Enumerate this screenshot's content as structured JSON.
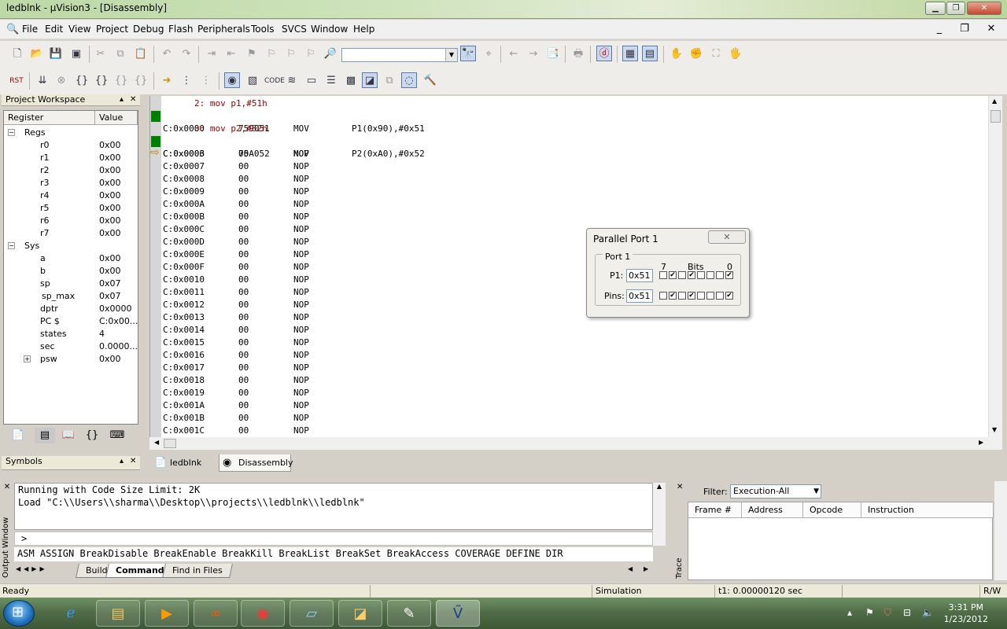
{
  "window": {
    "title": "ledblnk - µVision3 - [Disassembly]",
    "minimize": "▁",
    "maximize": "❐",
    "close": "✕"
  },
  "menu": [
    "File",
    "Edit",
    "View",
    "Project",
    "Debug",
    "Flash",
    "Peripherals",
    "Tools",
    "SVCS",
    "Window",
    "Help"
  ],
  "mdi": {
    "minimize": "_",
    "restore": "❐",
    "close": "✕"
  },
  "workspace": {
    "title": "Project Workspace",
    "pin": "▴",
    "close": "✕",
    "col_register": "Register",
    "col_value": "Value",
    "groups": [
      {
        "name": "Regs",
        "toggle": "−"
      },
      {
        "name": "Sys",
        "toggle": "−"
      }
    ],
    "regs": [
      {
        "name": "r0",
        "value": "0x00"
      },
      {
        "name": "r1",
        "value": "0x00"
      },
      {
        "name": "r2",
        "value": "0x00"
      },
      {
        "name": "r3",
        "value": "0x00"
      },
      {
        "name": "r4",
        "value": "0x00"
      },
      {
        "name": "r5",
        "value": "0x00"
      },
      {
        "name": "r6",
        "value": "0x00"
      },
      {
        "name": "r7",
        "value": "0x00"
      }
    ],
    "sys": [
      {
        "name": "a",
        "value": "0x00"
      },
      {
        "name": "b",
        "value": "0x00"
      },
      {
        "name": "sp",
        "value": "0x07"
      },
      {
        "name": "sp_max",
        "value": "0x07"
      },
      {
        "name": "dptr",
        "value": "0x0000"
      },
      {
        "name": "PC  $",
        "value": "C:0x00..."
      },
      {
        "name": "states",
        "value": "4"
      },
      {
        "name": "sec",
        "value": "0.0000..."
      },
      {
        "name": "psw",
        "value": "0x00",
        "toggle": "+"
      }
    ]
  },
  "symbols": {
    "title": "Symbols",
    "pin": "▴",
    "close": "✕"
  },
  "disassembly": {
    "src1": "2: mov p1,#51h",
    "src2": "3: mov p2,#52h",
    "instr": [
      {
        "addr": "C:0x0000",
        "bytes": "759051",
        "mn": "MOV",
        "ops": "P1(0x90),#0x51"
      },
      {
        "addr": "C:0x0003",
        "bytes": "75A052",
        "mn": "MOV",
        "ops": "P2(0xA0),#0x52"
      }
    ],
    "nops": [
      "C:0x0006",
      "C:0x0007",
      "C:0x0008",
      "C:0x0009",
      "C:0x000A",
      "C:0x000B",
      "C:0x000C",
      "C:0x000D",
      "C:0x000E",
      "C:0x000F",
      "C:0x0010",
      "C:0x0011",
      "C:0x0012",
      "C:0x0013",
      "C:0x0014",
      "C:0x0015",
      "C:0x0016",
      "C:0x0017",
      "C:0x0018",
      "C:0x0019",
      "C:0x001A",
      "C:0x001B",
      "C:0x001C"
    ],
    "nop_bytes": "00",
    "nop_mn": "NOP",
    "arrow": "⇨"
  },
  "doc_tabs": [
    "ledblnk",
    "Disassembly"
  ],
  "parallel_port": {
    "title": "Parallel Port 1",
    "close": "✕",
    "group": "Port 1",
    "bit_hi": "7",
    "bits_label": "Bits",
    "bit_lo": "0",
    "p1_label": "P1:",
    "p1_value": "0x51",
    "pins_label": "Pins:",
    "pins_value": "0x51",
    "check": "✔"
  },
  "output": {
    "vertical_title": "Output Window",
    "lines": [
      "Running with Code Size Limit: 2K",
      "Load \"C:\\\\Users\\\\sharma\\\\Desktop\\\\projects\\\\ledblnk\\\\ledblnk\""
    ],
    "prompt": ">",
    "command_help": "ASM ASSIGN BreakDisable BreakEnable BreakKill BreakList BreakSet BreakAccess COVERAGE DEFINE DIR",
    "tabs": [
      "Build",
      "Command",
      "Find in Files"
    ]
  },
  "trace": {
    "vertical_title": "Trace",
    "filter_label": "Filter:",
    "filter_value": "Execution-All",
    "columns": [
      "Frame #",
      "Address",
      "Opcode",
      "Instruction"
    ]
  },
  "status": {
    "ready": "Ready",
    "mode": "Simulation",
    "time": "t1: 0.00000120 sec",
    "rw": "R/W"
  },
  "taskbar": {
    "time": "3:31 PM",
    "date": "1/23/2012"
  }
}
